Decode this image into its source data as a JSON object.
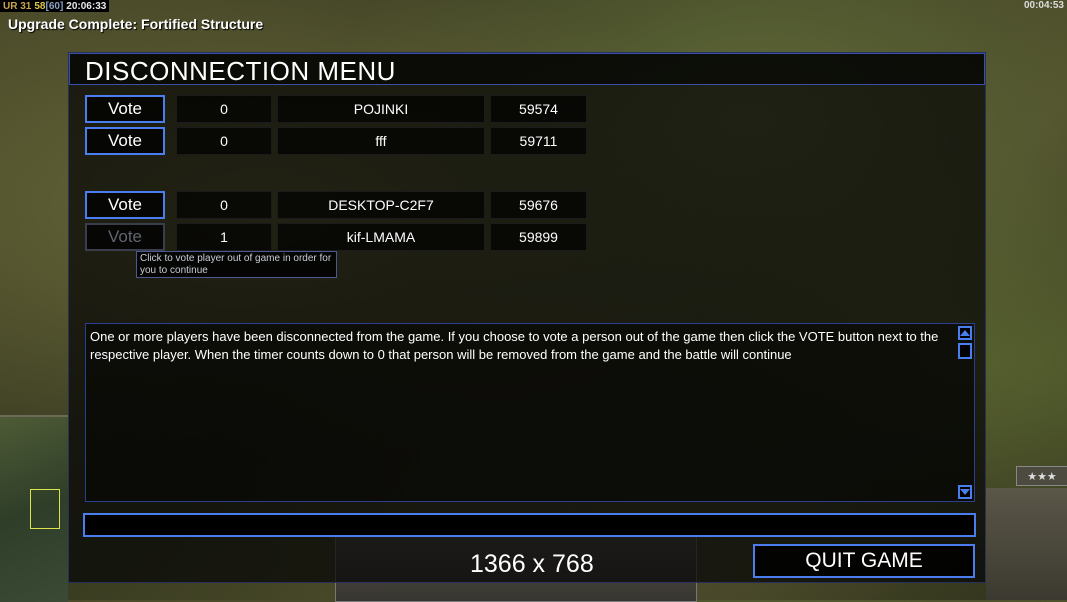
{
  "hud": {
    "top_left": [
      {
        "text": "UR 31",
        "color": "#c9a64a"
      },
      {
        "text": "58",
        "color": "#e0c844"
      },
      {
        "text": "[60]",
        "color": "#8aa0c8"
      },
      {
        "text": "20:06:33",
        "color": "#e8e8e8"
      }
    ],
    "top_right_time": "00:04:53",
    "notification": "Upgrade Complete: Fortified Structure",
    "rank_stars": "★★★"
  },
  "menu": {
    "title": "DISCONNECTION MENU",
    "vote_label": "Vote",
    "groups": [
      [
        {
          "votes": "0",
          "name": "POJINKI",
          "port": "59574",
          "enabled": true
        },
        {
          "votes": "0",
          "name": "fff",
          "port": "59711",
          "enabled": true
        }
      ],
      [
        {
          "votes": "0",
          "name": "DESKTOP-C2F7",
          "port": "59676",
          "enabled": true
        },
        {
          "votes": "1",
          "name": "kif-LMAMA",
          "port": "59899",
          "enabled": false
        }
      ]
    ],
    "tooltip": "Click to vote player out of game in order for you to continue",
    "message": "One or more players have been disconnected from the game. If you choose to vote a person out of the game then click the VOTE button next to the respective player. When the timer counts down to 0 that person will be removed from the game and the battle will continue",
    "quit_label": "QUIT GAME"
  },
  "overlay": {
    "resolution": "1366 x 768"
  },
  "colors": {
    "accent_blue": "#4a7ef0",
    "panel_bg": "#050505"
  }
}
